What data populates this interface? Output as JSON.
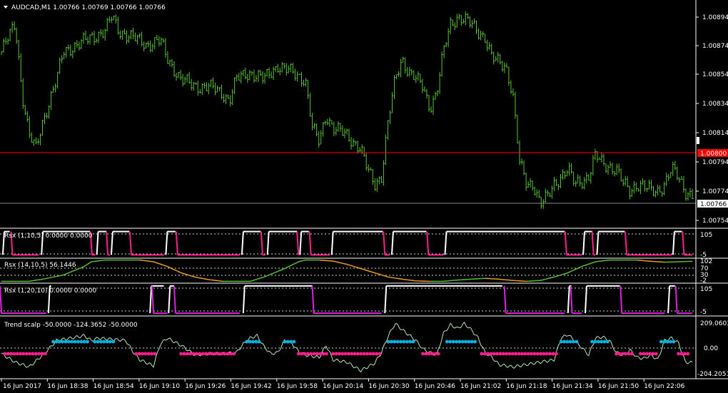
{
  "main": {
    "symbol_label": "AUDCAD,M1",
    "ohlc": "1.00766 1.00769 1.00766 1.00766",
    "price_ticks": [
      "1.00894",
      "1.00874",
      "1.00854",
      "1.00834",
      "1.00814",
      "1.00794",
      "1.00774",
      "1.00754"
    ],
    "current_price": "1.00766",
    "red_line_price": "1.00800",
    "colors": {
      "candles": "#58c332",
      "red_line": "#ff0000",
      "grid": "#ffffff",
      "bid_line": "#7f8c99"
    }
  },
  "indicators": [
    {
      "id": "rsx1",
      "label": "Rsx (1,10,5) 0.0000 0.0000",
      "scale": [
        "105",
        "-5"
      ]
    },
    {
      "id": "rsx2",
      "label": "Rsx (14,10,5) 56.1446",
      "scale": [
        "102",
        "70",
        "30",
        "-2"
      ]
    },
    {
      "id": "rsx3",
      "label": "Rsx (1,20,10) 0.0000 0.0000",
      "scale": [
        "105",
        "-5"
      ]
    },
    {
      "id": "trend",
      "label": "Trend scalp -50.0000 -124.3652 -50.0000",
      "scale": [
        "209.0603",
        "0.00",
        "-204.2051"
      ]
    }
  ],
  "time_axis": [
    "16 Jun 2017",
    "16 Jun 18:38",
    "16 Jun 18:54",
    "16 Jun 19:10",
    "16 Jun 19:26",
    "16 Jun 19:42",
    "16 Jun 19:58",
    "16 Jun 20:14",
    "16 Jun 20:30",
    "16 Jun 20:46",
    "16 Jun 21:02",
    "16 Jun 21:18",
    "16 Jun 21:34",
    "16 Jun 21:50",
    "16 Jun 22:06"
  ],
  "chart_data": {
    "type": "line",
    "x_domain": [
      0,
      100
    ],
    "price": {
      "ylim": [
        1.00745,
        1.00905
      ],
      "keypoints": [
        [
          0,
          1.0087
        ],
        [
          1,
          1.0088
        ],
        [
          2,
          1.0089
        ],
        [
          3,
          1.0084
        ],
        [
          4,
          1.0081
        ],
        [
          5,
          1.008
        ],
        [
          6,
          1.0082
        ],
        [
          8,
          1.0085
        ],
        [
          9,
          1.0087
        ],
        [
          11,
          1.00875
        ],
        [
          13,
          1.0088
        ],
        [
          15,
          1.00885
        ],
        [
          16,
          1.00895
        ],
        [
          17,
          1.00885
        ],
        [
          19,
          1.0088
        ],
        [
          21,
          1.00875
        ],
        [
          23,
          1.00878
        ],
        [
          24,
          1.00865
        ],
        [
          26,
          1.0085
        ],
        [
          28,
          1.00845
        ],
        [
          30,
          1.00845
        ],
        [
          32,
          1.0084
        ],
        [
          33,
          1.00835
        ],
        [
          34,
          1.0085
        ],
        [
          36,
          1.00855
        ],
        [
          38,
          1.0085
        ],
        [
          40,
          1.0086
        ],
        [
          42,
          1.00855
        ],
        [
          44,
          1.0085
        ],
        [
          45,
          1.00815
        ],
        [
          46,
          1.00805
        ],
        [
          47,
          1.00825
        ],
        [
          48,
          1.00815
        ],
        [
          50,
          1.0081
        ],
        [
          52,
          1.008
        ],
        [
          53,
          1.00785
        ],
        [
          54,
          1.00775
        ],
        [
          55,
          1.0078
        ],
        [
          56,
          1.0082
        ],
        [
          57,
          1.0085
        ],
        [
          58,
          1.00865
        ],
        [
          59,
          1.00855
        ],
        [
          60,
          1.0085
        ],
        [
          61,
          1.00845
        ],
        [
          62,
          1.0083
        ],
        [
          63,
          1.0084
        ],
        [
          64,
          1.0087
        ],
        [
          65,
          1.0089
        ],
        [
          66,
          1.00895
        ],
        [
          68,
          1.0089
        ],
        [
          70,
          1.0088
        ],
        [
          71,
          1.00865
        ],
        [
          73,
          1.0086
        ],
        [
          74,
          1.0084
        ],
        [
          75,
          1.0079
        ],
        [
          76,
          1.00775
        ],
        [
          77,
          1.00775
        ],
        [
          78,
          1.0076
        ],
        [
          79,
          1.00765
        ],
        [
          80,
          1.00775
        ],
        [
          81,
          1.0078
        ],
        [
          82,
          1.00785
        ],
        [
          83,
          1.00775
        ],
        [
          85,
          1.0078
        ],
        [
          86,
          1.00795
        ],
        [
          87,
          1.0079
        ],
        [
          89,
          1.00785
        ],
        [
          90,
          1.00775
        ],
        [
          91,
          1.0077
        ],
        [
          92,
          1.00775
        ],
        [
          94,
          1.0077
        ],
        [
          95,
          1.0077
        ],
        [
          96,
          1.00775
        ],
        [
          97,
          1.00785
        ],
        [
          98,
          1.0078
        ],
        [
          99,
          1.0077
        ],
        [
          100,
          1.00766
        ]
      ]
    },
    "rsx1": {
      "ylim": [
        -5,
        105
      ],
      "white_high_segments": [
        [
          0.2,
          1.2
        ],
        [
          5.8,
          12.8
        ],
        [
          13.8,
          15.2
        ],
        [
          15.9,
          18.5
        ],
        [
          23.8,
          25.2
        ],
        [
          34.8,
          37.5
        ],
        [
          38.5,
          42.8
        ],
        [
          43.2,
          44.5
        ],
        [
          47.8,
          55.2
        ],
        [
          56.5,
          61.5
        ],
        [
          64.2,
          81.5
        ],
        [
          84.2,
          85.5
        ],
        [
          86.2,
          90.2
        ],
        [
          97.2,
          98.5
        ]
      ],
      "pink_low_segments": [
        [
          1.6,
          5.4
        ],
        [
          13.1,
          13.6
        ],
        [
          15.4,
          15.7
        ],
        [
          18.8,
          23.5
        ],
        [
          25.5,
          34.5
        ],
        [
          37.8,
          38.2
        ],
        [
          43.0,
          43.1
        ],
        [
          44.8,
          47.5
        ],
        [
          55.5,
          56.2
        ],
        [
          61.8,
          64.0
        ],
        [
          81.8,
          84.0
        ],
        [
          85.7,
          86.0
        ],
        [
          90.5,
          97.0
        ],
        [
          98.8,
          100
        ]
      ]
    },
    "rsx2": {
      "ylim": [
        -2,
        102
      ],
      "keypoints": [
        [
          0,
          0
        ],
        [
          4,
          0
        ],
        [
          6,
          10
        ],
        [
          9,
          30
        ],
        [
          12,
          70
        ],
        [
          13,
          92
        ],
        [
          15,
          100
        ],
        [
          20,
          100
        ],
        [
          22,
          92
        ],
        [
          24,
          70
        ],
        [
          26,
          40
        ],
        [
          28,
          20
        ],
        [
          30,
          8
        ],
        [
          32,
          0
        ],
        [
          36,
          0
        ],
        [
          38,
          20
        ],
        [
          41,
          60
        ],
        [
          43,
          92
        ],
        [
          44,
          100
        ],
        [
          46,
          100
        ],
        [
          48,
          95
        ],
        [
          50,
          80
        ],
        [
          52,
          60
        ],
        [
          54,
          40
        ],
        [
          56,
          20
        ],
        [
          58,
          10
        ],
        [
          60,
          2
        ],
        [
          62,
          0
        ],
        [
          64,
          0
        ],
        [
          66,
          6
        ],
        [
          68,
          10
        ],
        [
          70,
          14
        ],
        [
          72,
          10
        ],
        [
          74,
          4
        ],
        [
          76,
          0
        ],
        [
          78,
          4
        ],
        [
          80,
          20
        ],
        [
          82,
          40
        ],
        [
          84,
          70
        ],
        [
          86,
          92
        ],
        [
          88,
          100
        ],
        [
          92,
          100
        ],
        [
          94,
          94
        ],
        [
          96,
          90
        ],
        [
          98,
          92
        ],
        [
          100,
          94
        ]
      ]
    },
    "rsx3": {
      "ylim": [
        -5,
        105
      ],
      "white_high_segments": [
        [
          6.8,
          7.2
        ],
        [
          21.5,
          23.5
        ],
        [
          24.2,
          25.0
        ],
        [
          35.0,
          45.0
        ],
        [
          55.5,
          72.5
        ],
        [
          82.0,
          82.5
        ],
        [
          84.5,
          89.5
        ],
        [
          96.5,
          97.5
        ]
      ],
      "pink_low_segments": [
        [
          0,
          6.5
        ],
        [
          22.0,
          24.0
        ],
        [
          25.2,
          34.5
        ],
        [
          45.2,
          55.0
        ],
        [
          73.0,
          81.5
        ],
        [
          82.6,
          84.0
        ],
        [
          89.8,
          96.0
        ],
        [
          97.8,
          100
        ]
      ]
    },
    "trend": {
      "ylim": [
        -240,
        240
      ],
      "keypoints": [
        [
          0,
          -50
        ],
        [
          2,
          -120
        ],
        [
          4,
          -160
        ],
        [
          6,
          -60
        ],
        [
          8,
          60
        ],
        [
          10,
          80
        ],
        [
          12,
          100
        ],
        [
          13,
          60
        ],
        [
          14,
          80
        ],
        [
          16,
          70
        ],
        [
          18,
          60
        ],
        [
          19,
          -30
        ],
        [
          20,
          -100
        ],
        [
          22,
          -150
        ],
        [
          23,
          30
        ],
        [
          24,
          80
        ],
        [
          26,
          20
        ],
        [
          28,
          -60
        ],
        [
          30,
          -50
        ],
        [
          32,
          -50
        ],
        [
          34,
          -40
        ],
        [
          35,
          30
        ],
        [
          36,
          80
        ],
        [
          37,
          100
        ],
        [
          38,
          10
        ],
        [
          39,
          -50
        ],
        [
          40,
          -40
        ],
        [
          41,
          60
        ],
        [
          42,
          40
        ],
        [
          43,
          -30
        ],
        [
          44,
          -60
        ],
        [
          46,
          -80
        ],
        [
          47,
          20
        ],
        [
          48,
          -100
        ],
        [
          50,
          -120
        ],
        [
          52,
          -190
        ],
        [
          54,
          -130
        ],
        [
          55,
          -40
        ],
        [
          56,
          100
        ],
        [
          57,
          200
        ],
        [
          58,
          150
        ],
        [
          60,
          60
        ],
        [
          61,
          -10
        ],
        [
          62,
          -40
        ],
        [
          63,
          -60
        ],
        [
          64,
          120
        ],
        [
          65,
          190
        ],
        [
          66,
          160
        ],
        [
          67,
          200
        ],
        [
          68,
          150
        ],
        [
          69,
          80
        ],
        [
          70,
          -40
        ],
        [
          71,
          -80
        ],
        [
          72,
          -140
        ],
        [
          74,
          -160
        ],
        [
          76,
          -140
        ],
        [
          78,
          -120
        ],
        [
          80,
          -100
        ],
        [
          81,
          80
        ],
        [
          82,
          110
        ],
        [
          84,
          0
        ],
        [
          85,
          -60
        ],
        [
          86,
          80
        ],
        [
          87,
          90
        ],
        [
          88,
          60
        ],
        [
          89,
          -40
        ],
        [
          90,
          -60
        ],
        [
          91,
          -20
        ],
        [
          92,
          -80
        ],
        [
          93,
          -90
        ],
        [
          94,
          -60
        ],
        [
          95,
          -100
        ],
        [
          96,
          60
        ],
        [
          97,
          80
        ],
        [
          98,
          40
        ],
        [
          99,
          -120
        ],
        [
          100,
          -124
        ]
      ],
      "blue_segments": [
        [
          7.5,
          12.5
        ],
        [
          13.5,
          16.5
        ],
        [
          35.5,
          37.5
        ],
        [
          41.0,
          42.5
        ],
        [
          56.0,
          60.0
        ],
        [
          64.5,
          69.0
        ],
        [
          81.0,
          83.5
        ],
        [
          85.5,
          88.0
        ],
        [
          95.5,
          97.5
        ]
      ],
      "pink_segments": [
        [
          0.5,
          6.5
        ],
        [
          19.5,
          22.5
        ],
        [
          26.0,
          34.0
        ],
        [
          43.0,
          47.5
        ],
        [
          48.0,
          55.0
        ],
        [
          61.0,
          63.5
        ],
        [
          69.5,
          80.5
        ],
        [
          89.0,
          91.5
        ],
        [
          92.5,
          95.0
        ],
        [
          98.0,
          99.5
        ]
      ]
    },
    "colors": {
      "white": "#ffffff",
      "pink": "#ff1e8c",
      "green": "#58c332",
      "orange": "#f0a020",
      "magenta": "#e020e0",
      "blue": "#00b4e6",
      "light_green": "#b4e6b4",
      "dashed": "#cfcfcf",
      "tag_bg": "#ffffff",
      "red_tag_bg": "#ff0000"
    }
  }
}
